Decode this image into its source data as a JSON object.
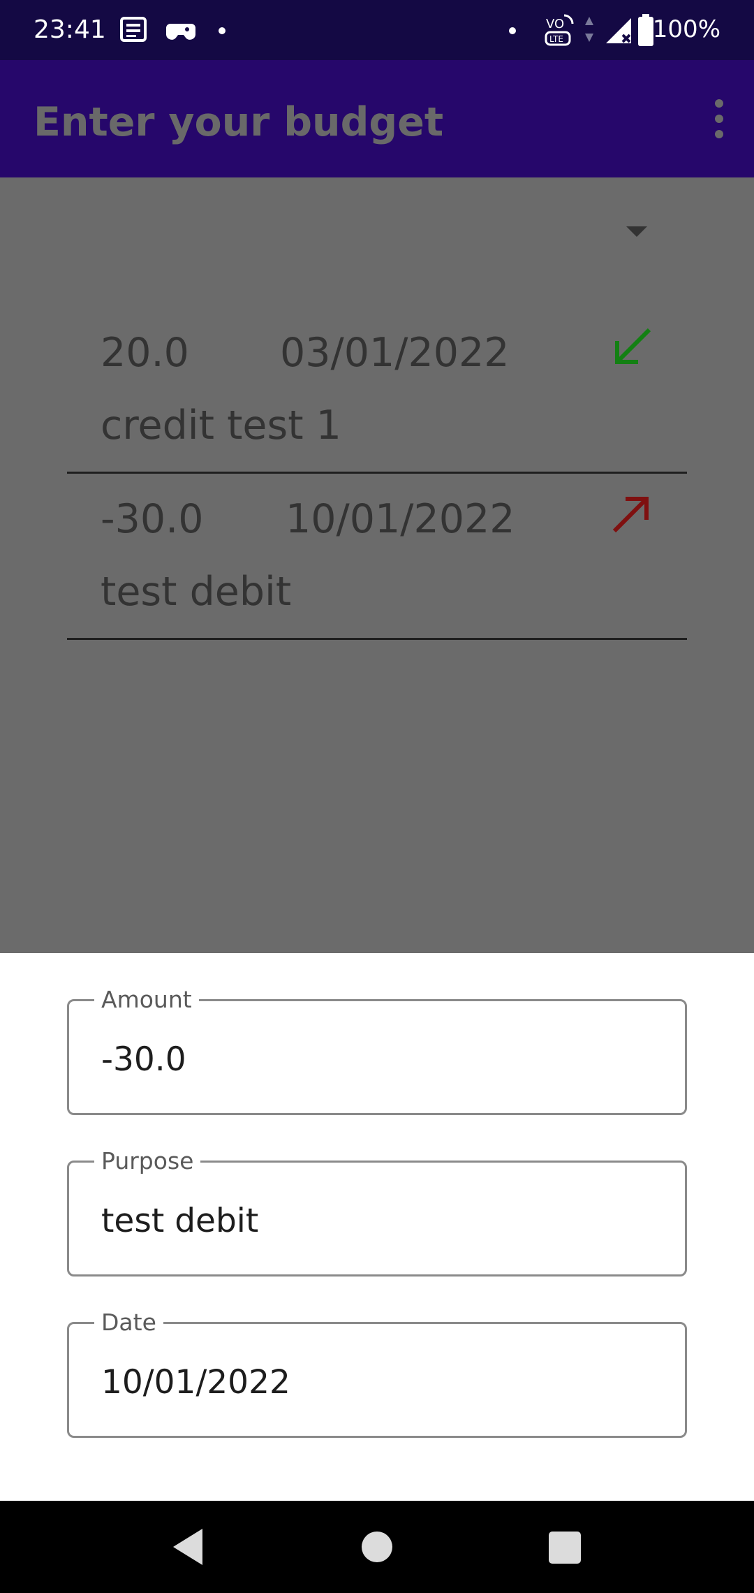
{
  "status_bar": {
    "time": "23:41",
    "battery": "100%",
    "icons": [
      "news-icon",
      "game-controller-icon",
      "dot-icon",
      "dot-icon",
      "volte-icon",
      "data-arrows-icon",
      "signal-icon",
      "battery-icon"
    ]
  },
  "app_bar": {
    "title": "Enter your budget",
    "overflow_icon": "more-vert-icon"
  },
  "transactions": [
    {
      "amount": "20.0",
      "date": "03/01/2022",
      "purpose": "credit test 1",
      "type_icon": "arrow-down-left-icon",
      "color": "#138013"
    },
    {
      "amount": "-30.0",
      "date": "10/01/2022",
      "purpose": "test debit",
      "type_icon": "arrow-up-right-icon",
      "color": "#7f1010"
    }
  ],
  "form": {
    "amount_label": "Amount",
    "amount_value": "-30.0",
    "purpose_label": "Purpose",
    "purpose_value": "test debit",
    "date_label": "Date",
    "date_value": "10/01/2022"
  },
  "colors": {
    "status_bar": "#140944",
    "app_bar": "#26076b",
    "scrim": "#6b6b6b",
    "credit": "#138013",
    "debit": "#7f1010"
  }
}
